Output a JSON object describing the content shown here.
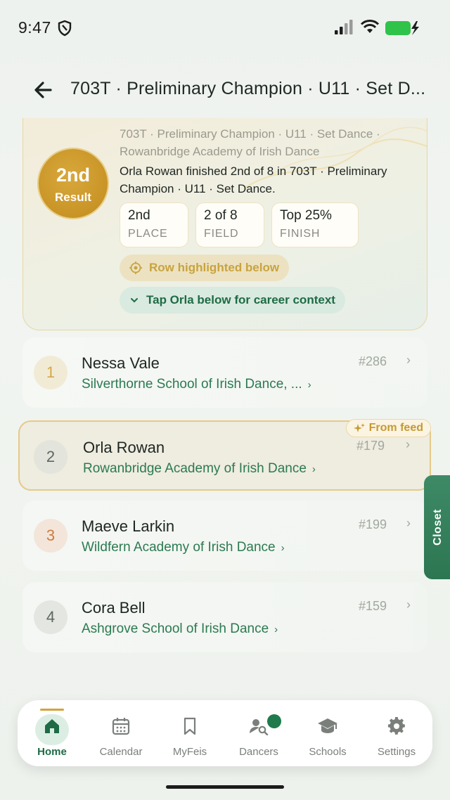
{
  "status": {
    "time": "9:47"
  },
  "header": {
    "title": "703T · Preliminary Champion · U11 · Set D..."
  },
  "result": {
    "place": "2nd",
    "place_sub": "Result",
    "crumb": "703T · Preliminary Champion · U11 · Set Dance · Rowanbridge Academy of Irish Dance",
    "summary": "Orla Rowan finished 2nd of 8 in 703T · Preliminary Champion · U11 · Set Dance.",
    "stats": [
      {
        "value": "2nd",
        "label": "PLACE"
      },
      {
        "value": "2 of 8",
        "label": "FIELD"
      },
      {
        "value": "Top 25%",
        "label": "FINISH"
      }
    ],
    "highlight_pill": "Row highlighted below",
    "career_pill": "Tap Orla below for career context"
  },
  "rows": [
    {
      "num": "1",
      "name": "Nessa Vale",
      "school": "Silverthorne School of Irish Dance, ...",
      "rank": "#286"
    },
    {
      "num": "2",
      "name": "Orla Rowan",
      "school": "Rowanbridge Academy of Irish Dance",
      "rank": "#179",
      "badge": "From feed"
    },
    {
      "num": "3",
      "name": "Maeve Larkin",
      "school": "Wildfern Academy of Irish Dance",
      "rank": "#199"
    },
    {
      "num": "4",
      "name": "Cora Bell",
      "school": "Ashgrove School of Irish Dance",
      "rank": "#159"
    }
  ],
  "closet": {
    "label": "Closet"
  },
  "nav": [
    {
      "label": "Home",
      "icon": "home-icon",
      "active": true
    },
    {
      "label": "Calendar",
      "icon": "calendar-icon"
    },
    {
      "label": "MyFeis",
      "icon": "bookmark-icon"
    },
    {
      "label": "Dancers",
      "icon": "dancers-search-icon"
    },
    {
      "label": "Schools",
      "icon": "graduation-cap-icon"
    },
    {
      "label": "Settings",
      "icon": "gear-icon"
    }
  ],
  "colors": {
    "accent": "#1e6b45",
    "gold": "#c99426",
    "highlight_border": "#e5c988"
  }
}
